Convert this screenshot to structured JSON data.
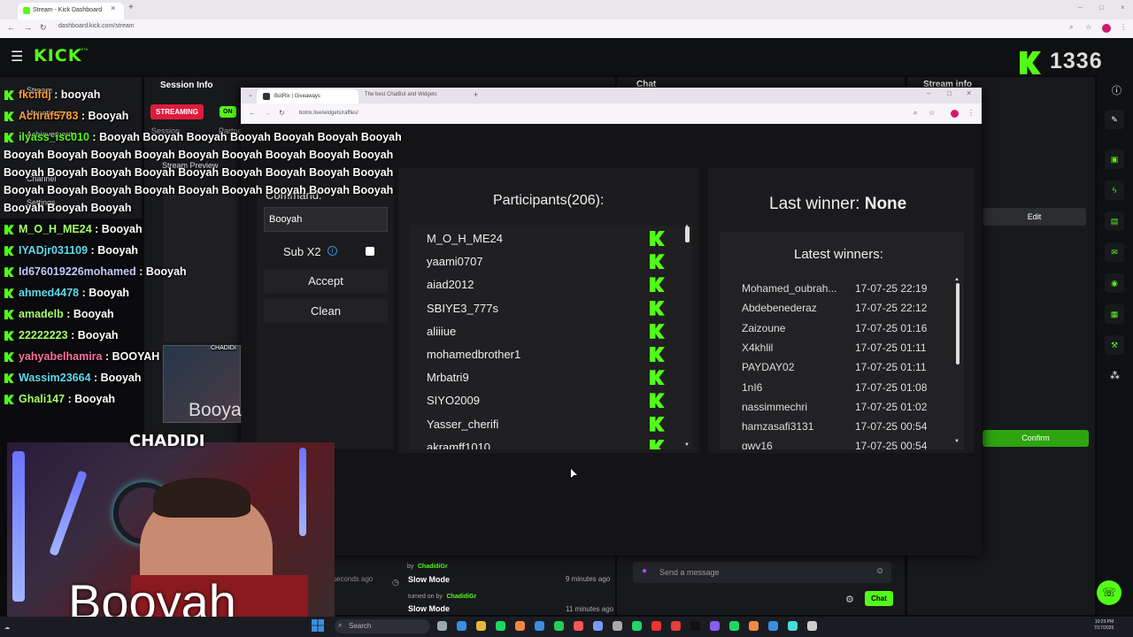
{
  "outer_browser": {
    "tab_title": "Stream - Kick Dashboard",
    "url": "dashboard.kick.com/stream"
  },
  "kick": {
    "logo": "KICK",
    "beta": "BETA",
    "viewer_count": "1336",
    "session_info": {
      "title": "Session Info",
      "streaming_badge": "STREAMING",
      "on_badge": "ON",
      "session_label": "Session",
      "partner_label": "Partner"
    },
    "sidebar": {
      "stream": "Stream",
      "monetization": "Monetization",
      "achievements": "Achievements",
      "channel": "Channel",
      "stream_preview": "Stream Preview",
      "settings": "Settings"
    },
    "chat": {
      "title": "Chat",
      "placeholder": "Send a message",
      "send_button": "Chat"
    },
    "stream_info": {
      "title": "Stream info",
      "edit_button": "Edit",
      "confirm_button": "Confirm"
    },
    "activity": [
      {
        "by_prefix": "by",
        "by_user": "ChadidiGr"
      },
      {
        "title": "Slow Mode",
        "detail_prefix": "turned on by",
        "detail_user": "ChadidiGr",
        "time": "9 minutes ago"
      },
      {
        "title": "Slow Mode",
        "time": "11 minutes ago"
      }
    ],
    "activity_time_left": "seconds ago"
  },
  "inner_browser": {
    "tab1": "BotRix | Giveaways",
    "tab2": "The best ChatBot and Widgets",
    "url": "botrix.live/widgets/raffles/"
  },
  "raffle": {
    "command_label": "Command:",
    "command_value": "Booyah",
    "sub_x2_label": "Sub X2",
    "sub_x2_checked": false,
    "accept_button": "Accept",
    "clean_button": "Clean",
    "participants_header": "Participants(206):",
    "participants": [
      "M_O_H_ME24",
      "yaami0707",
      "aiad2012",
      "SBIYE3_777s",
      "aliiiue",
      "mohamedbrother1",
      "Mrbatri9",
      "SIYO2009",
      "Yasser_cherifi",
      "akramff1010"
    ],
    "last_winner_label": "Last winner:",
    "last_winner_value": "None",
    "latest_winners_header": "Latest winners:",
    "latest_winners": [
      {
        "name": "Mohamed_oubrah...",
        "date": "17-07-25 22:19"
      },
      {
        "name": "Abdebenederaz",
        "date": "17-07-25 22:12"
      },
      {
        "name": "Zaizoune",
        "date": "17-07-25 01:16"
      },
      {
        "name": "X4khlil",
        "date": "17-07-25 01:11"
      },
      {
        "name": "PAYDAY02",
        "date": "17-07-25 01:11"
      },
      {
        "name": "1nI6",
        "date": "17-07-25 01:08"
      },
      {
        "name": "nassimmechri",
        "date": "17-07-25 01:02"
      },
      {
        "name": "hamzasafi3131",
        "date": "17-07-25 00:54"
      },
      {
        "name": "gwy16",
        "date": "17-07-25 00:54"
      }
    ]
  },
  "chat_overlay": [
    {
      "user": "fkcifdj",
      "msg": "booyah"
    },
    {
      "user": "Achraf5783",
      "msg": "Booyah"
    },
    {
      "user": "ilyass_isc010",
      "msg": "Booyah Booyah Booyah Booyah Booyah Booyah Booyah"
    },
    {
      "user": "",
      "msg": "Booyah Booyah Booyah Booyah Booyah Booyah Booyah Booyah Booyah"
    },
    {
      "user": "",
      "msg": "Booyah Booyah Booyah Booyah Booyah Booyah Booyah Booyah Booyah"
    },
    {
      "user": "",
      "msg": "Booyah Booyah Booyah Booyah Booyah Booyah Booyah Booyah Booyah"
    },
    {
      "user": "",
      "msg": "Booyah Booyah Booyah"
    },
    {
      "user": "M_O_H_ME24",
      "msg": "Booyah"
    },
    {
      "user": "IYADjr031109",
      "msg": "Booyah"
    },
    {
      "user": "Id676019226mohamed",
      "msg": "Booyah"
    },
    {
      "user": "ahmed4478",
      "msg": "Booyah"
    },
    {
      "user": "amadelb",
      "msg": "Booyah"
    },
    {
      "user": "22222223",
      "msg": "Booyah"
    },
    {
      "user": "yahyabelhamira",
      "msg": "BOOYAH"
    },
    {
      "user": "Wassim23664",
      "msg": "Booyah"
    },
    {
      "user": "Ghali147",
      "msg": "Booyah"
    }
  ],
  "webcam": {
    "streamer_name": "CHADIDI",
    "caption": "Booyah",
    "mini_caption": "Booya"
  },
  "taskbar": {
    "search_placeholder": "Search",
    "time": "10:23 PM",
    "date": "7/17/2025"
  },
  "colors": {
    "kick_green": "#53fc18",
    "streaming_red": "#e01b3c",
    "panel": "#18191c",
    "botrix_panel": "#1b1b1e"
  }
}
